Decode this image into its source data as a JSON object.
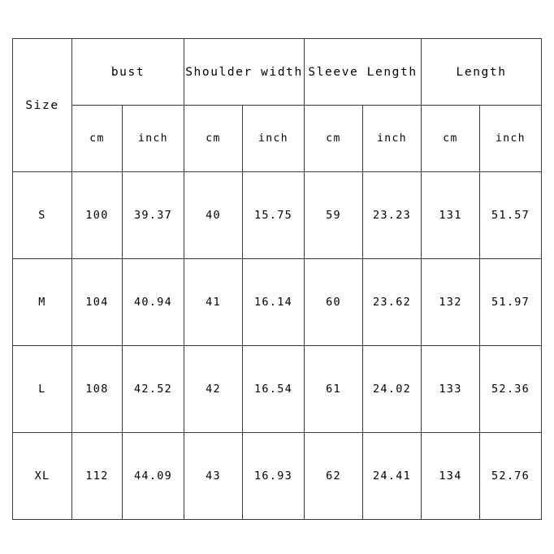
{
  "table": {
    "size_header": "Size",
    "groups": [
      {
        "label": "bust",
        "span": 2
      },
      {
        "label": "Shoulder width",
        "span": 2
      },
      {
        "label": "Sleeve Length",
        "span": 2
      },
      {
        "label": "Length",
        "span": 2
      }
    ],
    "units": [
      "cm",
      "inch",
      "cm",
      "inch",
      "cm",
      "inch",
      "cm",
      "inch"
    ],
    "rows": [
      {
        "size": "S",
        "values": [
          "100",
          "39.37",
          "40",
          "15.75",
          "59",
          "23.23",
          "131",
          "51.57"
        ]
      },
      {
        "size": "M",
        "values": [
          "104",
          "40.94",
          "41",
          "16.14",
          "60",
          "23.62",
          "132",
          "51.97"
        ]
      },
      {
        "size": "L",
        "values": [
          "108",
          "42.52",
          "42",
          "16.54",
          "61",
          "24.02",
          "133",
          "52.36"
        ]
      },
      {
        "size": "XL",
        "values": [
          "112",
          "44.09",
          "43",
          "16.93",
          "62",
          "24.41",
          "134",
          "52.76"
        ]
      }
    ]
  },
  "colors": {
    "background": "#ffffff",
    "border": "#3a3a3a",
    "text": "#000000"
  }
}
